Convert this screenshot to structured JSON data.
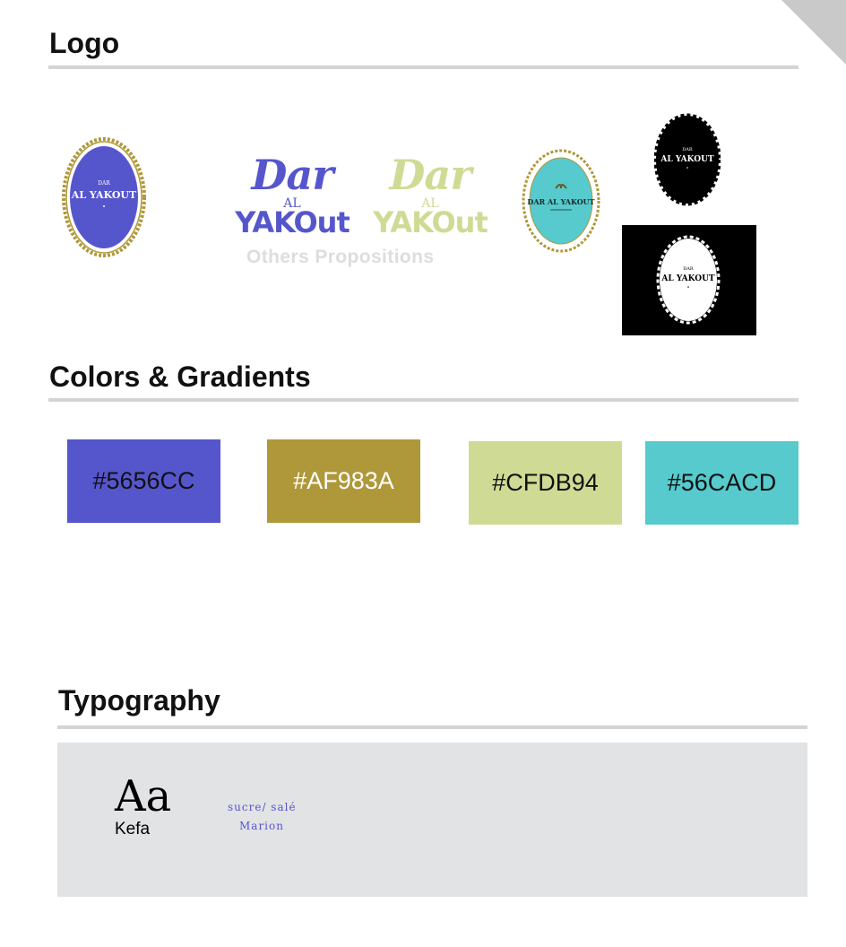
{
  "sections": {
    "logo": "Logo",
    "colors": "Colors & Gradients",
    "typography": "Typography"
  },
  "logos": {
    "brand_line1": "DAR",
    "brand_line2": "AL YAKOUT",
    "wordmark_dar": "Dar",
    "wordmark_al": "AL",
    "wordmark_yakout": "YAKOut",
    "propositions": "Others Propositions",
    "teal_badge_name": "DAR AL YAKOUT"
  },
  "colors": {
    "accent": "#5656CC",
    "gold": "#AF983A",
    "green": "#CFDB94",
    "teal": "#56CACD"
  },
  "swatches": [
    {
      "hex": "#5656CC",
      "text_color": "#111111"
    },
    {
      "hex": "#AF983A",
      "text_color": "#ffffff"
    },
    {
      "hex": "#CFDB94",
      "text_color": "#111111"
    },
    {
      "hex": "#56CACD",
      "text_color": "#111111"
    }
  ],
  "typography": {
    "sample": "Aa",
    "font_name": "Kefa",
    "secondary_sample": "sucre/ salé",
    "secondary_font": "Marion"
  }
}
